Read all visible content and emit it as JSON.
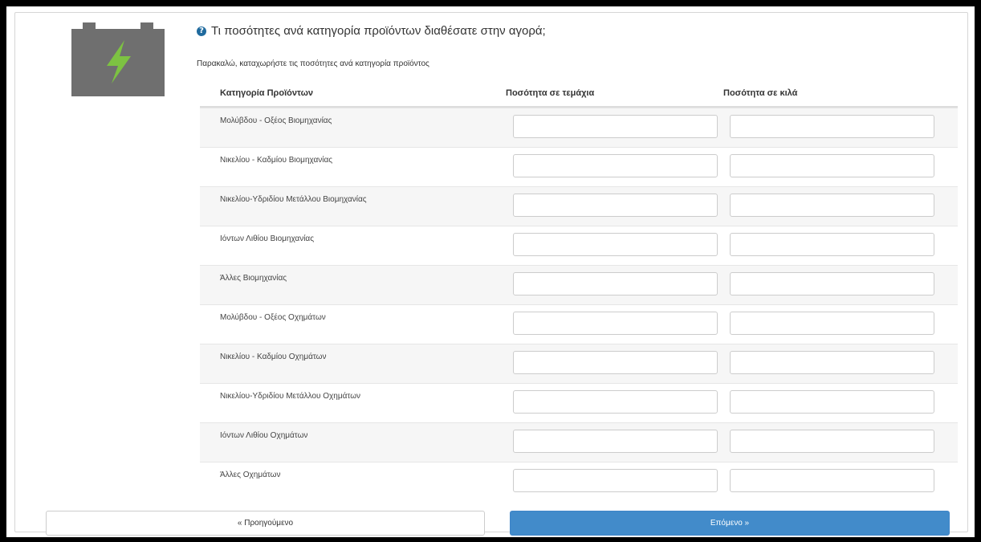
{
  "header": {
    "question": "Τι ποσότητες ανά κατηγορία προϊόντων διαθέσατε στην αγορά;",
    "question_icon": "?",
    "instruction": "Παρακαλώ, καταχωρήστε τις ποσότητες ανά κατηγορία προϊόντος",
    "battery_icon_color": "#6f6f6f",
    "bolt_color": "#7dc242"
  },
  "table": {
    "headers": [
      "Κατηγορία Προϊόντων",
      "Ποσότητα σε τεμάχια",
      "Ποσότητα σε κιλά"
    ],
    "rows": [
      {
        "label": "Μολύβδου - Οξέος Βιομηχανίας",
        "pieces": "",
        "kg": ""
      },
      {
        "label": "Νικελίου - Καδμίου Βιομηχανίας",
        "pieces": "",
        "kg": ""
      },
      {
        "label": "Νικελίου-Υδριδίου Μετάλλου Βιομηχανίας",
        "pieces": "",
        "kg": ""
      },
      {
        "label": "Ιόντων Λιθίου Βιομηχανίας",
        "pieces": "",
        "kg": ""
      },
      {
        "label": "Άλλες Βιομηχανίας",
        "pieces": "",
        "kg": ""
      },
      {
        "label": "Μολύβδου - Οξέος Οχημάτων",
        "pieces": "",
        "kg": ""
      },
      {
        "label": "Νικελίου - Καδμίου Οχημάτων",
        "pieces": "",
        "kg": ""
      },
      {
        "label": "Νικελίου-Υδριδίου Μετάλλου Οχημάτων",
        "pieces": "",
        "kg": ""
      },
      {
        "label": "Ιόντων Λιθίου Οχημάτων",
        "pieces": "",
        "kg": ""
      },
      {
        "label": "Άλλες Οχημάτων",
        "pieces": "",
        "kg": ""
      }
    ]
  },
  "footer": {
    "prev_label": "« Προηγούμενο",
    "next_label": "Επόμενο »",
    "accent_color": "#428bca"
  }
}
